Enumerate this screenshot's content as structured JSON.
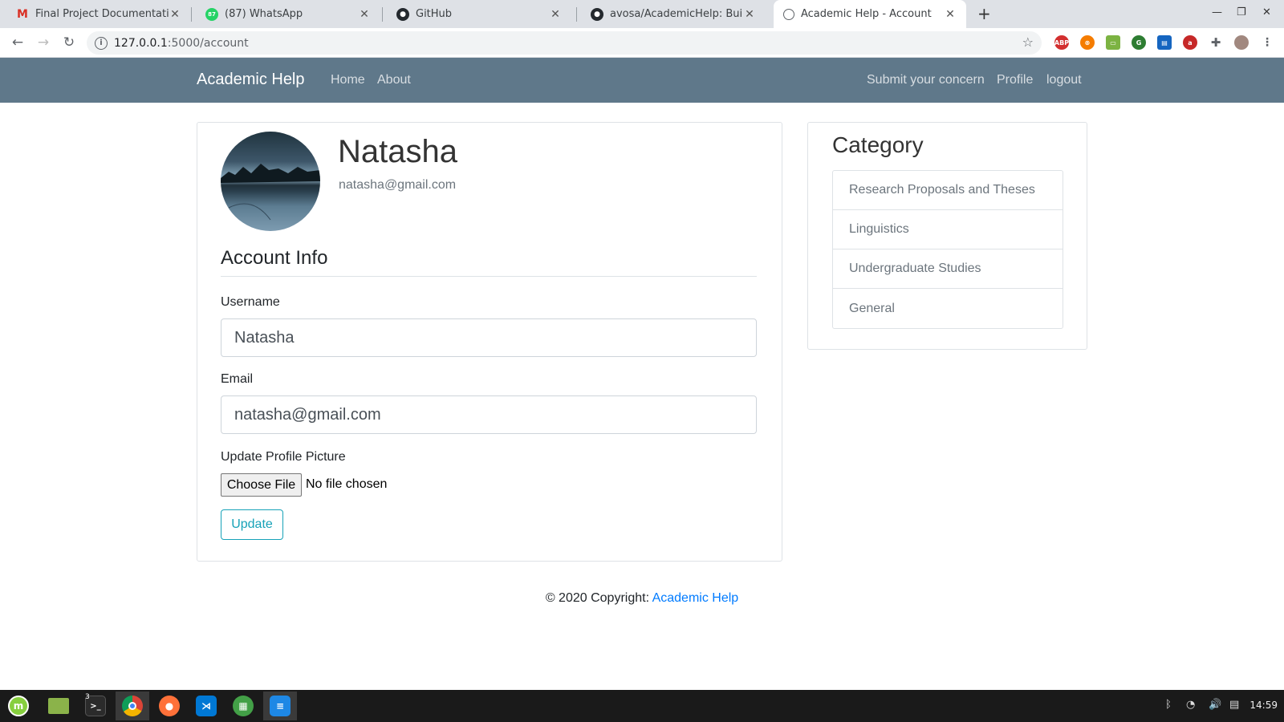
{
  "browser": {
    "tabs": [
      {
        "title": "Final Project Documentation -",
        "favicon": "gmail-icon"
      },
      {
        "title": "(87) WhatsApp",
        "favicon": "whatsapp-icon"
      },
      {
        "title": "GitHub",
        "favicon": "github-icon"
      },
      {
        "title": "avosa/AcademicHelp: Building",
        "favicon": "github-icon"
      },
      {
        "title": "Academic Help - Account",
        "favicon": "globe-icon",
        "active": true
      }
    ],
    "new_tab": "+",
    "url_host": "127.0.0.1",
    "url_path": ":5000/account",
    "extensions": [
      "ABP",
      "ext-orange",
      "ext-green",
      "ext-green2",
      "ext-blue",
      "ext-red",
      "puzzle-icon",
      "profile-avatar"
    ]
  },
  "site": {
    "brand": "Academic Help",
    "nav_left": [
      "Home",
      "About"
    ],
    "nav_right": [
      "Submit your concern",
      "Profile",
      "logout"
    ]
  },
  "profile": {
    "name": "Natasha",
    "email": "natasha@gmail.com"
  },
  "form": {
    "section_title": "Account Info",
    "username_label": "Username",
    "username_value": "Natasha",
    "email_label": "Email",
    "email_value": "natasha@gmail.com",
    "picture_label": "Update Profile Picture",
    "file_button": "Choose File",
    "file_status": "No file chosen",
    "submit_label": "Update"
  },
  "sidebar": {
    "title": "Category",
    "items": [
      "Research Proposals and Theses",
      "Linguistics",
      "Undergraduate Studies",
      "General"
    ]
  },
  "footer": {
    "text": "© 2020 Copyright: ",
    "link": "Academic Help"
  },
  "taskbar": {
    "terminal_badge": "3",
    "clock": "14:59"
  },
  "colors": {
    "navbar": "#5f788a",
    "accent": "#17a2b8",
    "link": "#007bff"
  }
}
